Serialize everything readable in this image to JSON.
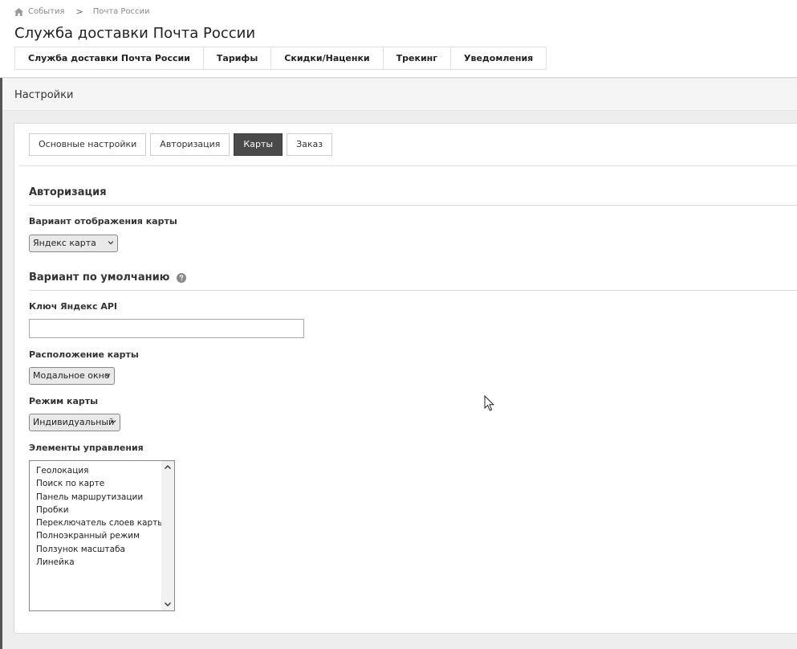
{
  "breadcrumb": {
    "home_label": "События",
    "separator": ">",
    "current": "Почта России"
  },
  "header": {
    "title": "Служба доставки Почта России"
  },
  "main_tabs": [
    {
      "label": "Служба доставки Почта России"
    },
    {
      "label": "Тарифы"
    },
    {
      "label": "Скидки/Наценки"
    },
    {
      "label": "Трекинг"
    },
    {
      "label": "Уведомления"
    }
  ],
  "section": {
    "title": "Настройки"
  },
  "sub_tabs": [
    {
      "label": "Основные настройки",
      "active": false
    },
    {
      "label": "Авторизация",
      "active": false
    },
    {
      "label": "Карты",
      "active": true
    },
    {
      "label": "Заказ",
      "active": false
    }
  ],
  "form": {
    "section_auth": "Авторизация",
    "map_variant_label": "Вариант отображения карты",
    "map_variant_value": "Яндекс карта",
    "section_default": "Вариант по умолчанию",
    "api_key_label": "Ключ Яндекс API",
    "api_key_value": "",
    "map_position_label": "Расположение карты",
    "map_position_value": "Модальное окно",
    "map_mode_label": "Режим карты",
    "map_mode_value": "Индивидуальный",
    "controls_label": "Элементы управления",
    "controls_options": [
      "Геолокация",
      "Поиск по карте",
      "Панель маршрутизации",
      "Пробки",
      "Переключатель слоев карты",
      "Полноэкранный режим",
      "Ползунок масштаба",
      "Линейка"
    ]
  },
  "icons": {
    "home": "home-icon",
    "help": "help-circle-icon",
    "chevron": "chevron-down-icon",
    "cursor": "mouse-pointer-icon"
  },
  "colors": {
    "active_tab_bg": "#4a4a4a",
    "page_bg": "#eeeeee",
    "card_bg": "#ffffff"
  }
}
